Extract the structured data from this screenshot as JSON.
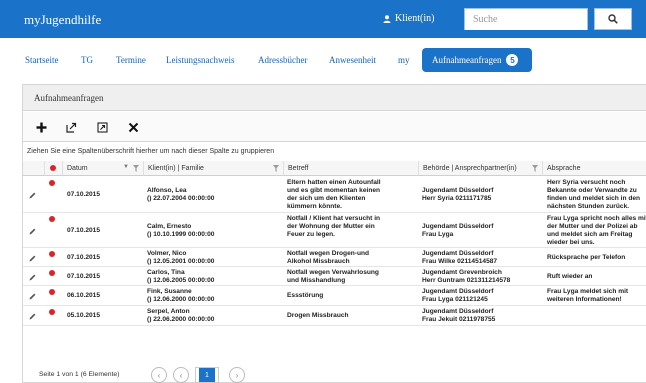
{
  "app": {
    "brand": "myJugendhilfe",
    "user": "Klient(in)"
  },
  "search": {
    "placeholder": "Suche"
  },
  "nav": {
    "items": [
      "Startseite",
      "TG",
      "Termine",
      "Leistungsnachweis",
      "Adressbücher",
      "Anwesenheit",
      "my"
    ],
    "active_label": "Aufnahmeanfragen",
    "active_badge": "5"
  },
  "panel": {
    "title": "Aufnahmeanfragen",
    "group_hint": "Ziehen Sie eine Spaltenüberschrift hierher um nach dieser Spalte zu gruppieren"
  },
  "toolbar": {
    "icons": [
      "add-icon",
      "export-icon",
      "open-icon",
      "delete-icon"
    ]
  },
  "columns": {
    "datum": "Datum",
    "klient": "Klient(in) | Familie",
    "betreff": "Betreff",
    "behoerde": "Behörde | Ansprechpartner(in)",
    "absprache": "Absprache"
  },
  "rows": [
    {
      "date": "07.10.2015",
      "klient1": "Alfonso, Lea",
      "klient2": "() 22.07.2004 00:00:00",
      "betreff": [
        "Eltern hatten einen Autounfall",
        "und es gibt momentan keinen",
        "der sich um den Klienten",
        "kümmern könnte."
      ],
      "behoerde1": "Jugendamt Düsseldorf",
      "behoerde2": "Herr Syria 0211171785",
      "absprache": [
        "Herr Syria versucht noch",
        "Bekannte oder Verwandte zu",
        "finden und meldet sich in den",
        "nächsten Stunden zurück."
      ]
    },
    {
      "date": "07.10.2015",
      "klient1": "Calm, Ernesto",
      "klient2": "() 10.10.1999 00:00:00",
      "betreff": [
        "Notfall / Klient hat versucht in",
        "der Wohnung der Mutter ein",
        "Feuer zu legen."
      ],
      "behoerde1": "Jugendamt Düsseldorf",
      "behoerde2": "Frau Lyga",
      "absprache": [
        "Frau Lyga spricht noch alles mit",
        "der Mutter und der Polizei ab",
        "und meldet sich am Freitag",
        "wieder bei uns."
      ]
    },
    {
      "date": "07.10.2015",
      "klient1": "Volmer, Nico",
      "klient2": "() 12.05.2001 00:00:00",
      "betreff": [
        "Notfall wegen Drogen-und",
        "Alkohol Missbrauch"
      ],
      "behoerde1": "Jugendamt Düsseldorf",
      "behoerde2": "Frau Wilke 02114514587",
      "absprache": [
        "Rücksprache per Telefon"
      ]
    },
    {
      "date": "07.10.2015",
      "klient1": "Carlos, Tina",
      "klient2": "() 12.06.2005 00:00:00",
      "betreff": [
        "Notfall wegen Verwahrlosung",
        "und Misshandlung"
      ],
      "behoerde1": "Jugendamt Grevenbroich",
      "behoerde2": "Herr Guntram 021311214578",
      "absprache": [
        "Ruft wieder an"
      ]
    },
    {
      "date": "06.10.2015",
      "klient1": "Fink, Susanne",
      "klient2": "() 12.06.2000 00:00:00",
      "betreff": [
        "Essstörung"
      ],
      "behoerde1": "Jugendamt Düsseldorf",
      "behoerde2": "Frau Lyga 021121245",
      "absprache": [
        "Frau Lyga meldet sich mit",
        "weiteren Informationen!"
      ]
    },
    {
      "date": "05.10.2015",
      "klient1": "Serpel, Anton",
      "klient2": "() 22.06.2000 00:00:00",
      "betreff": [
        "Drogen Missbrauch"
      ],
      "behoerde1": "Jugendamt Düsseldorf",
      "behoerde2": "Frau Jekuit 0211978755",
      "absprache": []
    }
  ],
  "pager": {
    "text": "Seite 1 von 1 (6 Elemente)",
    "current": "1"
  },
  "colors": {
    "primary": "#1a73c9",
    "flag": "#d9252a"
  }
}
